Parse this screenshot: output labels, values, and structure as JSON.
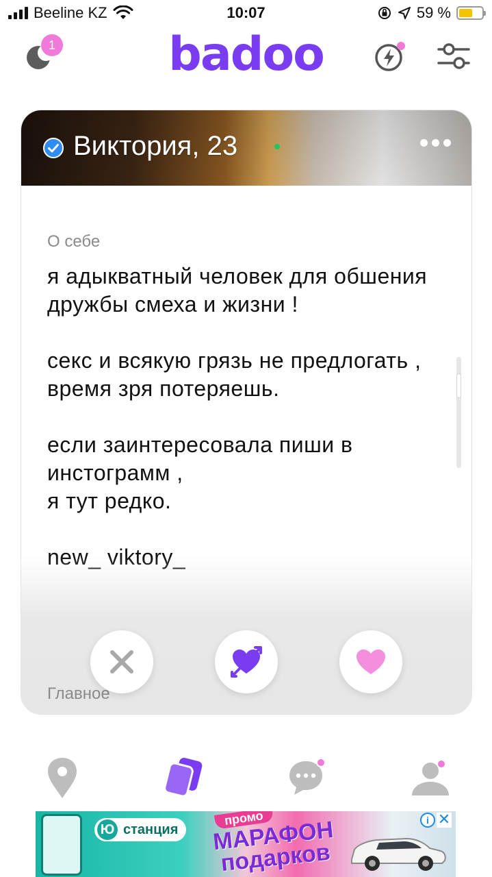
{
  "status_bar": {
    "carrier": "Beeline KZ",
    "time": "10:07",
    "battery_percent": "59 %",
    "battery_level": 0.59
  },
  "header": {
    "logo": "badoo",
    "notification_count": "1",
    "accent_color": "#7a3cf0",
    "badge_color": "#f07ad8"
  },
  "profile": {
    "name_age": "Виктория, 23",
    "verified": true,
    "online": true,
    "about_label": "О себе",
    "about_text": "я адыкватный человек для обшения дружбы смеха и жизни !\n\nсекс и всякую грязь не предлогать , время зря потеряешь.\n\nесли заинтересовала пиши в инстограмм ,\nя тут редко.\n\nnew_ viktory_",
    "main_label": "Главное"
  },
  "actions": {
    "pass_icon": "close-icon",
    "crush_icon": "heart-arrow-icon",
    "like_icon": "heart-icon"
  },
  "bottom_nav": {
    "items": [
      "location-pin-icon",
      "cards-icon",
      "chat-icon",
      "profile-icon"
    ],
    "active": "cards-icon"
  },
  "ad": {
    "brand": "станция",
    "promo": "промо",
    "title_line1": "МАРАФОН",
    "title_line2": "подарков"
  }
}
